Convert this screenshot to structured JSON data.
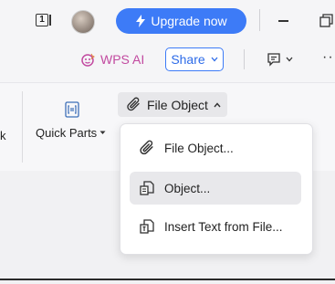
{
  "titlebar": {
    "window_number": "1",
    "upgrade_label": "Upgrade now"
  },
  "subbar": {
    "wps_ai_label": "WPS AI",
    "share_label": "Share",
    "more_label": "···"
  },
  "ribbon": {
    "truncated_label": "k",
    "quick_parts_label": "Quick Parts",
    "file_object_label": "File Object"
  },
  "menu": {
    "items": [
      {
        "label": "File Object..."
      },
      {
        "label": "Object..."
      },
      {
        "label": "Insert Text from File..."
      }
    ],
    "highlighted_index": 1
  },
  "colors": {
    "accent": "#3d7bf7",
    "wps_ai": "#c24aa0"
  }
}
